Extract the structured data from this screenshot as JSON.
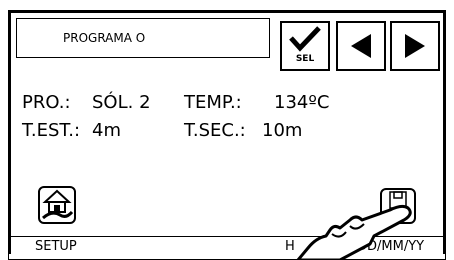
{
  "program": {
    "name": "PROGRAMA O"
  },
  "toolbar": {
    "sel_label": "SEL"
  },
  "info": {
    "pro_label": "PRO.:",
    "pro_value": "SÓL. 2",
    "temp_label": "TEMP.:",
    "temp_value": "134ºC",
    "test_label": "T.EST.:",
    "test_value": "4m",
    "tsec_label": "T.SEC.:",
    "tsec_value": "10m"
  },
  "save": {
    "label": "SAVE"
  },
  "status": {
    "setup_label": "SETUP",
    "time_label": "H",
    "date_label": "DD/MM/YY"
  },
  "colors": {
    "line": "#000000",
    "background": "#ffffff"
  },
  "icons": [
    "checkmark-icon",
    "arrow-left-icon",
    "arrow-right-icon",
    "house-setup-icon",
    "floppy-save-icon",
    "pointing-hand-icon"
  ]
}
